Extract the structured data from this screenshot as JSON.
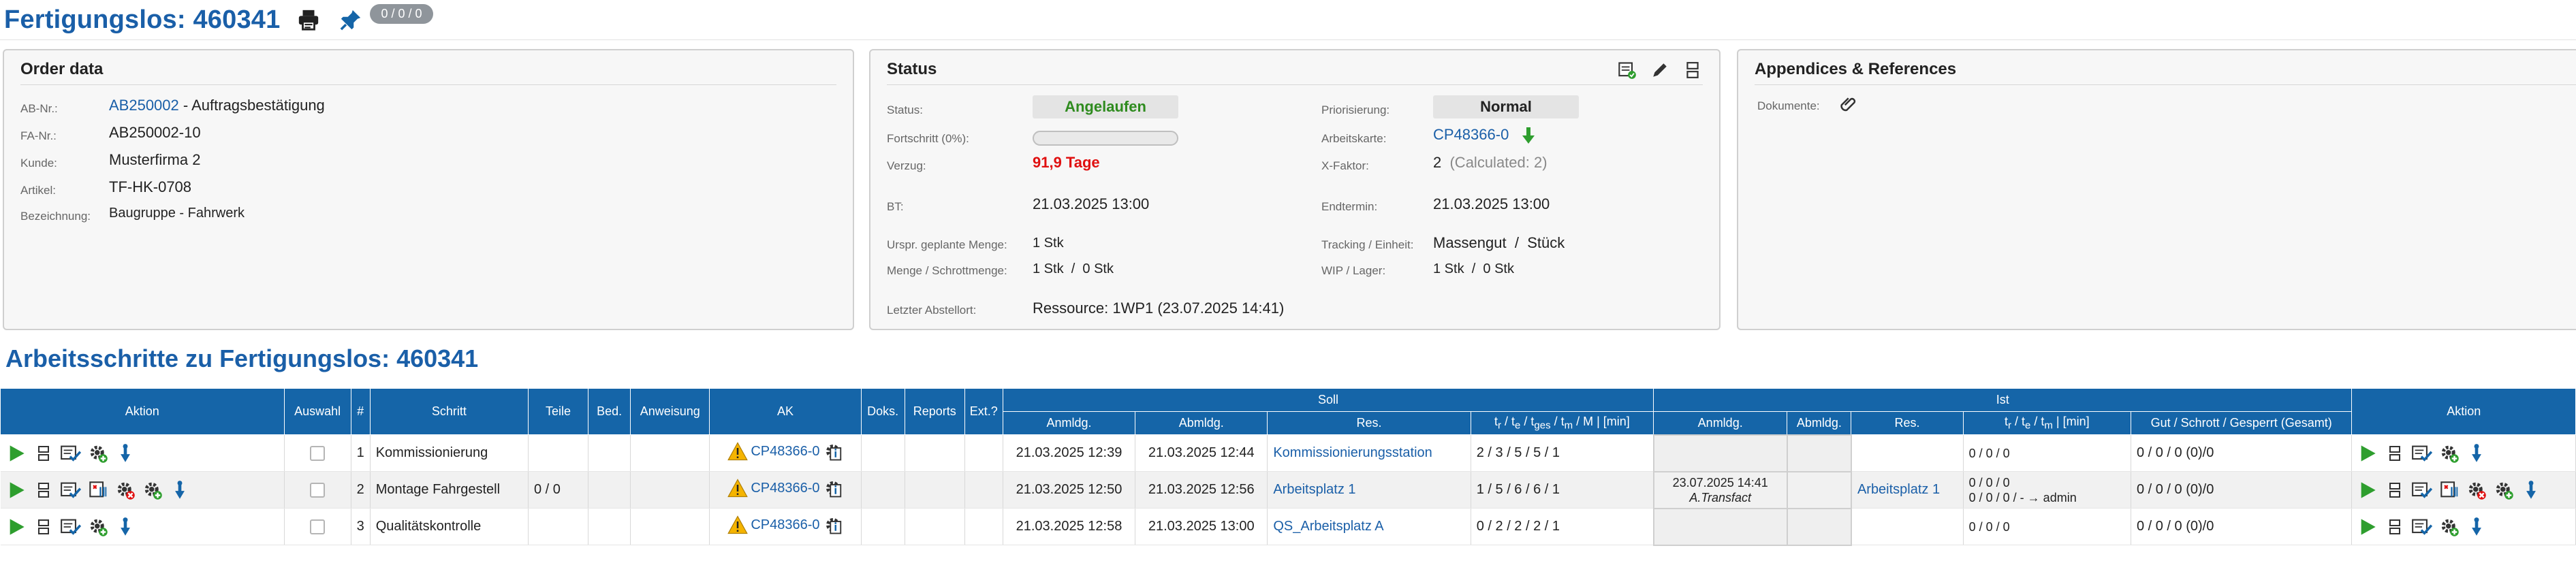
{
  "header": {
    "title": "Fertigungslos: 460341",
    "counter": "0 / 0 / 0"
  },
  "order": {
    "title": "Order data",
    "labels": {
      "ab": "AB-Nr.:",
      "fa": "FA-Nr.:",
      "kunde": "Kunde:",
      "artikel": "Artikel:",
      "bez": "Bezeichnung:"
    },
    "ab_link": "AB250002",
    "ab_suffix": " - Auftragsbestätigung",
    "fa": "AB250002-10",
    "kunde": "Musterfirma 2",
    "artikel": "TF-HK-0708",
    "bezeichnung": "Baugruppe - Fahrwerk"
  },
  "status": {
    "title": "Status",
    "labels": {
      "status": "Status:",
      "fortschritt": "Fortschritt (0%):",
      "verzug": "Verzug:",
      "bt": "BT:",
      "menge": "Urspr. geplante Menge:",
      "schrott": "Menge / Schrottmenge:",
      "abstell": "Letzter Abstellort:",
      "prio": "Priorisierung:",
      "ak": "Arbeitskarte:",
      "xfaktor": "X-Faktor:",
      "end": "Endtermin:",
      "tracking": "Tracking / Einheit:",
      "wip": "WIP / Lager:"
    },
    "status_value": "Angelaufen",
    "progress_pct": 0,
    "verzug": "91,9 Tage",
    "bt": "21.03.2025 13:00",
    "menge": "1 Stk",
    "schrott_a": "1 Stk",
    "schrott_b": "0 Stk",
    "abstell": "Ressource:  1WP1  (23.07.2025 14:41)",
    "prio_value": "Normal",
    "ak_link": "CP48366-0",
    "xfaktor": "2",
    "xfaktor_calc": "(Calculated: 2)",
    "end": "21.03.2025 13:00",
    "tracking_a": "Massengut",
    "tracking_b": "Stück",
    "wip_a": "1 Stk",
    "wip_b": "0 Stk",
    "slash": "/"
  },
  "appendix": {
    "title": "Appendices & References",
    "dok_label": "Dokumente:"
  },
  "section": {
    "title": "Arbeitsschritte zu Fertigungslos: 460341"
  },
  "table": {
    "h_aktion": "Aktion",
    "h_auswahl": "Auswahl",
    "h_nr": "#",
    "h_schritt": "Schritt",
    "h_teile": "Teile",
    "h_bed": "Bed.",
    "h_anw": "Anweisung",
    "h_ak": "AK",
    "h_doks": "Doks.",
    "h_reports": "Reports",
    "h_ext": "Ext.?",
    "h_soll": "Soll",
    "h_ist": "Ist",
    "h_aktion2": "Aktion",
    "h_anm": "Anmldg.",
    "h_abm": "Abmldg.",
    "h_res": "Res.",
    "h_times_soll": "tr / te / tges / tm / M | [min]",
    "h_anm2": "Anmldg.",
    "h_abm2": "Abmldg.",
    "h_res2": "Res.",
    "h_times_ist": "tr / te / tm | [min]",
    "h_gut": "Gut / Schrott / Gesperrt (Gesamt)",
    "rows": [
      {
        "nr": "1",
        "schritt": "Kommissionierung",
        "teile": "",
        "ak": "CP48366-0",
        "anm": "21.03.2025 12:39",
        "abm": "21.03.2025 12:44",
        "res": "Kommissionierungsstation",
        "times": "2 / 3 / 5 / 5 / 1",
        "ist_anm": "",
        "ist_anm2": "",
        "ist_res": "",
        "ist_times": "0 / 0 / 0",
        "ist_times2": "",
        "gut": "0 / 0 / 0 (0)/0"
      },
      {
        "nr": "2",
        "schritt": "Montage Fahrgestell",
        "teile": "0 / 0",
        "ak": "CP48366-0",
        "anm": "21.03.2025 12:50",
        "abm": "21.03.2025 12:56",
        "res": "Arbeitsplatz 1",
        "times": "1 / 5 / 6 / 6 / 1",
        "ist_anm": "23.07.2025 14:41",
        "ist_anm2": "A.Transfact",
        "ist_res": "Arbeitsplatz 1",
        "ist_times": "0 / 0 / 0",
        "ist_times2": "0 / 0 / 0 / - → admin",
        "gut": "0 / 0 / 0 (0)/0"
      },
      {
        "nr": "3",
        "schritt": "Qualitätskontrolle",
        "teile": "",
        "ak": "CP48366-0",
        "anm": "21.03.2025 12:58",
        "abm": "21.03.2025 13:00",
        "res": "QS_Arbeitsplatz A",
        "times": "0 / 2 / 2 / 2 / 1",
        "ist_anm": "",
        "ist_anm2": "",
        "ist_res": "",
        "ist_times": "0 / 0 / 0",
        "ist_times2": "",
        "gut": "0 / 0 / 0 (0)/0"
      }
    ]
  },
  "colors": {
    "brand": "#1565a8",
    "link": "#1a5fa8",
    "ok": "#2e8b1e",
    "danger": "#e01010",
    "play": "#2e9e2e"
  },
  "icons": [
    "printer-icon",
    "pin-icon",
    "play-icon",
    "split-icon",
    "checklist-icon",
    "gear-add-icon",
    "arrow-down-icon",
    "warning-icon",
    "document-info-icon",
    "paperclip-icon",
    "edit-icon",
    "barcode-icon",
    "gear-remove-icon",
    "info-icon"
  ]
}
